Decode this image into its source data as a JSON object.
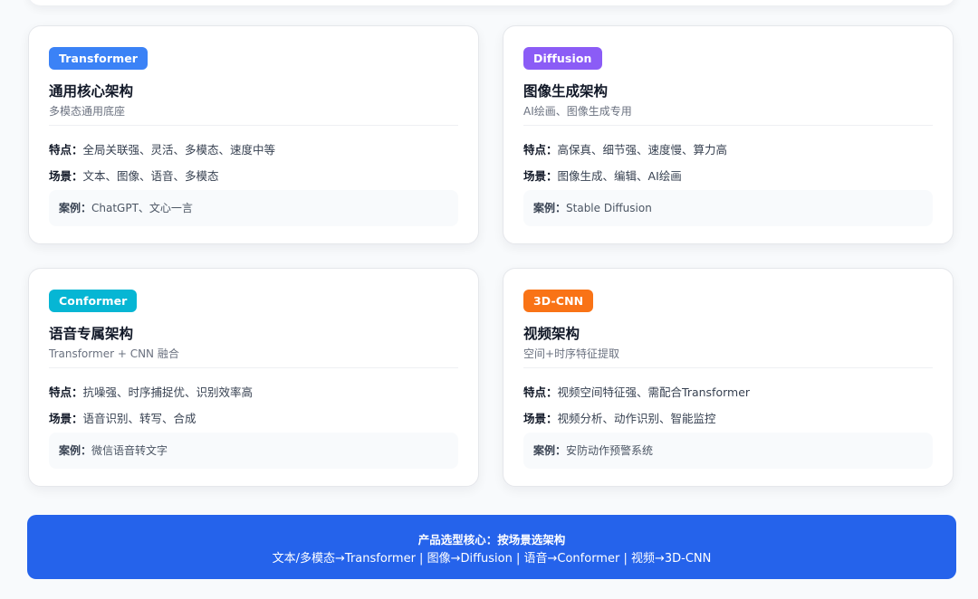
{
  "colors": {
    "transformer": "#3b82f6",
    "diffusion": "#8b5cf6",
    "conformer": "#06b6d4",
    "cnn3d": "#f97316",
    "banner": "#2563eb"
  },
  "labels": {
    "features": "特点：",
    "scenes": "场景：",
    "case": "案例："
  },
  "cards": [
    {
      "badge": "Transformer",
      "title": "通用核心架构",
      "subtitle": "多模态通用底座",
      "features": "全局关联强、灵活、多模态、速度中等",
      "scenes": "文本、图像、语音、多模态",
      "case": "ChatGPT、文心一言"
    },
    {
      "badge": "Diffusion",
      "title": "图像生成架构",
      "subtitle": "AI绘画、图像生成专用",
      "features": "高保真、细节强、速度慢、算力高",
      "scenes": "图像生成、编辑、AI绘画",
      "case": "Stable Diffusion"
    },
    {
      "badge": "Conformer",
      "title": "语音专属架构",
      "subtitle": "Transformer + CNN 融合",
      "features": "抗噪强、时序捕捉优、识别效率高",
      "scenes": "语音识别、转写、合成",
      "case": "微信语音转文字"
    },
    {
      "badge": "3D-CNN",
      "title": "视频架构",
      "subtitle": "空间+时序特征提取",
      "features": "视频空间特征强、需配合Transformer",
      "scenes": "视频分析、动作识别、智能监控",
      "case": "安防动作预警系统"
    }
  ],
  "banner": {
    "title": "产品选型核心：按场景选架构",
    "text": "文本/多模态→Transformer | 图像→Diffusion | 语音→Conformer | 视频→3D-CNN"
  }
}
